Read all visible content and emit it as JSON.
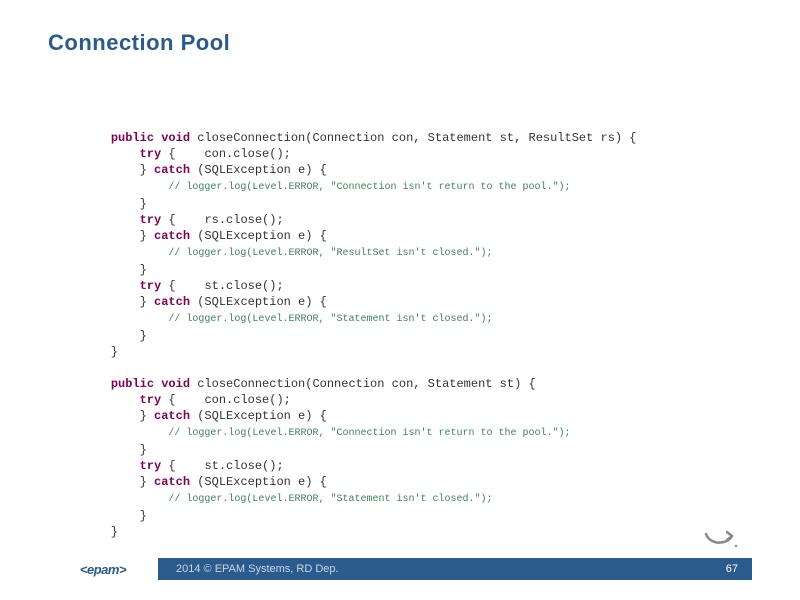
{
  "title": "Connection Pool",
  "code": {
    "m1_sig_pre": "    ",
    "m1_sig_kw": "public void",
    "m1_sig_rest": " closeConnection(Connection con, Statement st, ResultSet rs) {",
    "try_kw": "try",
    "catch_kw": "catch",
    "try_open": " {    ",
    "con_close": "con.close();",
    "rs_close": "rs.close();",
    "st_close": "st.close();",
    "catch_rest": " (SQLException e) {",
    "close_brace2": "        } ",
    "indent2": "        ",
    "indent3": "            ",
    "cmt_conn": "// logger.log(Level.ERROR, \"Connection isn't return to the pool.\");",
    "cmt_rs": "// logger.log(Level.ERROR, \"ResultSet isn't closed.\");",
    "cmt_st": "// logger.log(Level.ERROR, \"Statement isn't closed.\");",
    "close_inner": "        }",
    "close_outer": "    }",
    "blank": "",
    "m2_sig_rest": " closeConnection(Connection con, Statement st) {"
  },
  "footer": {
    "logo": "<epam>",
    "text": "2014 © EPAM Systems, RD Dep.",
    "page": "67"
  }
}
